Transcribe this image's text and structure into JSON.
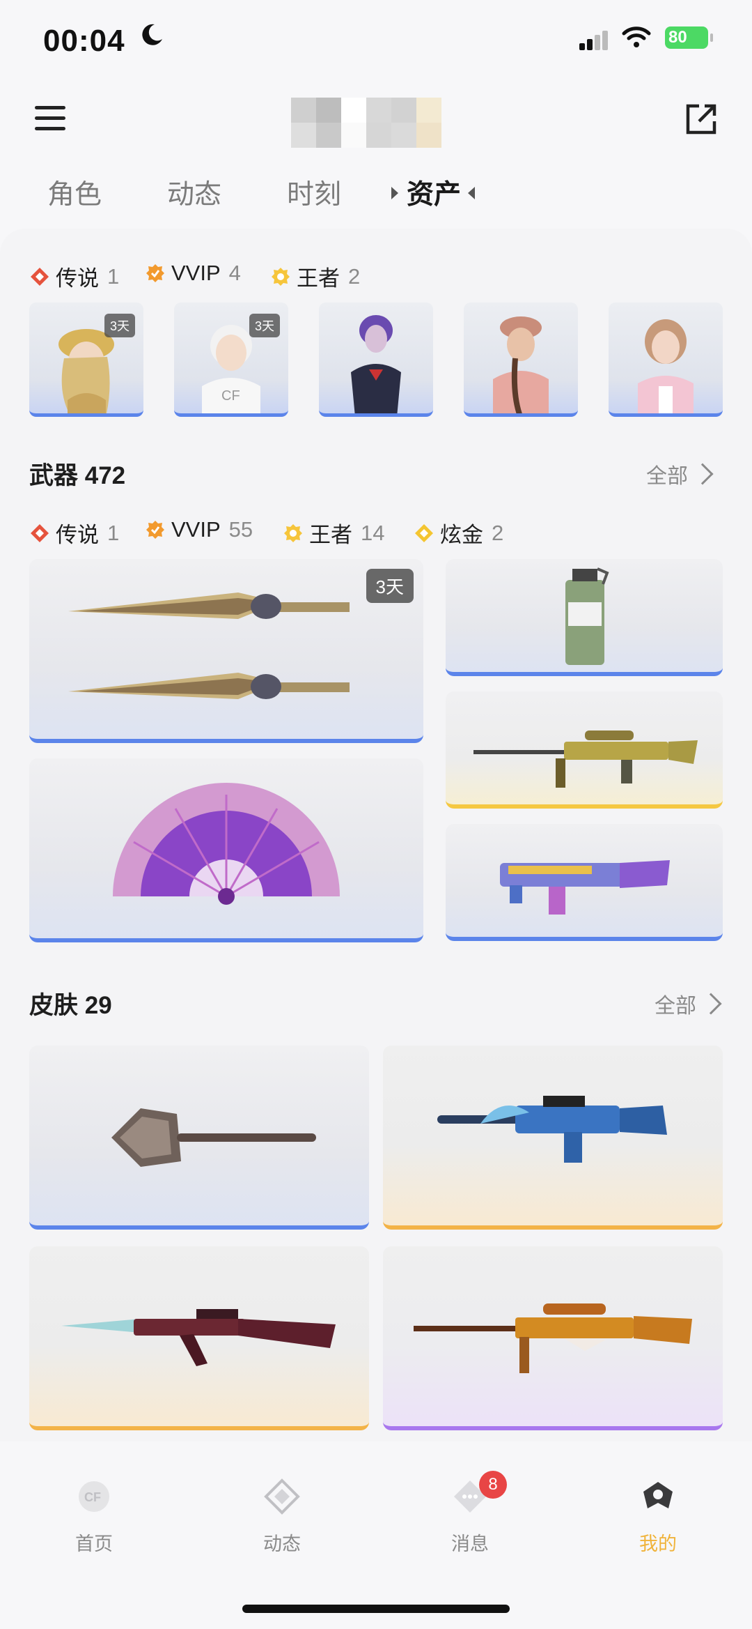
{
  "status_bar": {
    "time": "00:04",
    "battery": "80"
  },
  "tabs": [
    "角色",
    "动态",
    "时刻",
    "资产"
  ],
  "characters": {
    "rarity": [
      {
        "label": "传说",
        "count": "1",
        "color": "#e5533d"
      },
      {
        "label": "VVIP",
        "count": "4",
        "color": "#f29a2e"
      },
      {
        "label": "王者",
        "count": "2",
        "color": "#f6c53b"
      }
    ],
    "items": [
      {
        "badge": "3天"
      },
      {
        "badge": "3天"
      },
      {
        "badge": ""
      },
      {
        "badge": ""
      },
      {
        "badge": ""
      }
    ]
  },
  "weapons": {
    "title": "武器 472",
    "all_label": "全部",
    "rarity": [
      {
        "label": "传说",
        "count": "1",
        "color": "#e5533d"
      },
      {
        "label": "VVIP",
        "count": "55",
        "color": "#f29a2e"
      },
      {
        "label": "王者",
        "count": "14",
        "color": "#f6c53b"
      },
      {
        "label": "炫金",
        "count": "2",
        "color": "#f4c531"
      }
    ],
    "badge": "3天"
  },
  "skins": {
    "title": "皮肤 29",
    "all_label": "全部"
  },
  "bottom_nav": [
    {
      "label": "首页",
      "icon": "cf-logo-icon"
    },
    {
      "label": "动态",
      "icon": "diamond-icon"
    },
    {
      "label": "消息",
      "icon": "chat-icon",
      "badge": "8"
    },
    {
      "label": "我的",
      "icon": "profile-icon",
      "active": true
    }
  ],
  "colors": {
    "accent": "#f0b33a",
    "rarity_blue": "#5b84ea",
    "rarity_gold": "#f5c842",
    "rarity_orange": "#f3b347",
    "rarity_purple": "#a877ee"
  }
}
